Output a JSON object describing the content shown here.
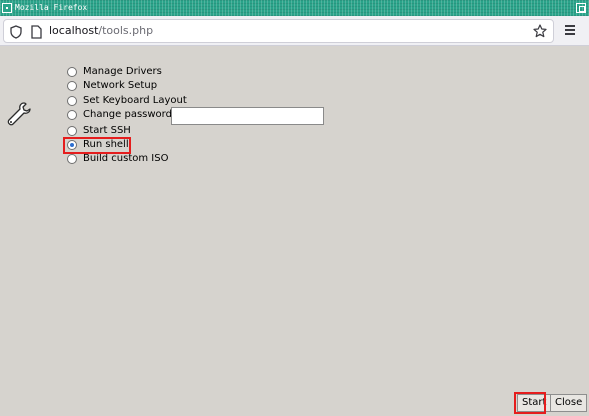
{
  "window": {
    "title": "Mozilla Firefox"
  },
  "navbar": {
    "url_host": "localhost",
    "url_path": "/tools.php"
  },
  "tools": {
    "options": [
      {
        "label": "Manage Drivers",
        "checked": false
      },
      {
        "label": "Network Setup",
        "checked": false
      },
      {
        "label": "Set Keyboard Layout",
        "checked": false
      },
      {
        "label": "Change password",
        "checked": false
      },
      {
        "label": "Start SSH",
        "checked": false
      },
      {
        "label": "Run shell",
        "checked": true
      },
      {
        "label": "Build custom ISO",
        "checked": false
      }
    ],
    "password_value": ""
  },
  "buttons": {
    "start_label": "Start",
    "close_label": "Close"
  },
  "colors": {
    "highlight": "#e51d1d",
    "titlebar": "#2aa38a",
    "background": "#d6d3ce"
  }
}
